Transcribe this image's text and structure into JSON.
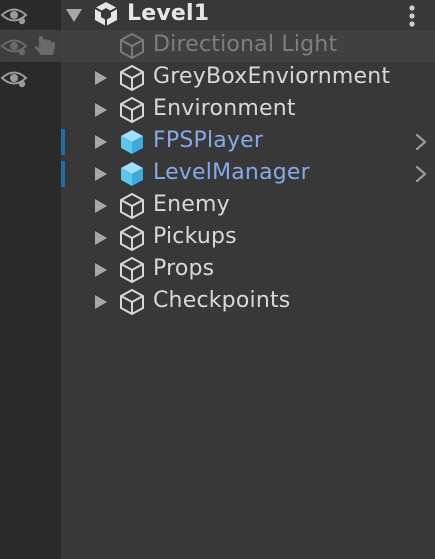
{
  "scene": {
    "name": "Level1",
    "icon": "unity-logo-icon",
    "menu_icon": "kebab-menu-icon"
  },
  "items": [
    {
      "label": "Directional Light",
      "state": "disabled",
      "icon": "gameobject-cube-icon"
    },
    {
      "label": "GreyBoxEnviornment",
      "state": "normal",
      "icon": "gameobject-cube-icon"
    },
    {
      "label": "Environment",
      "state": "normal",
      "icon": "gameobject-cube-icon"
    },
    {
      "label": "FPSPlayer",
      "state": "prefab",
      "icon": "prefab-cube-icon"
    },
    {
      "label": "LevelManager",
      "state": "prefab",
      "icon": "prefab-cube-icon"
    },
    {
      "label": "Enemy",
      "state": "normal",
      "icon": "gameobject-cube-icon"
    },
    {
      "label": "Pickups",
      "state": "normal",
      "icon": "gameobject-cube-icon"
    },
    {
      "label": "Props",
      "state": "normal",
      "icon": "gameobject-cube-icon"
    },
    {
      "label": "Checkpoints",
      "state": "normal",
      "icon": "gameobject-cube-icon"
    }
  ],
  "colors": {
    "background": "#383838",
    "gutter": "#2a2a2a",
    "text": "#d8d8d8",
    "text_disabled": "#7e7e7e",
    "prefab_text": "#86a9ea",
    "prefab_icon": "#5ec4f0",
    "prefab_marker": "#1e6ea8"
  }
}
